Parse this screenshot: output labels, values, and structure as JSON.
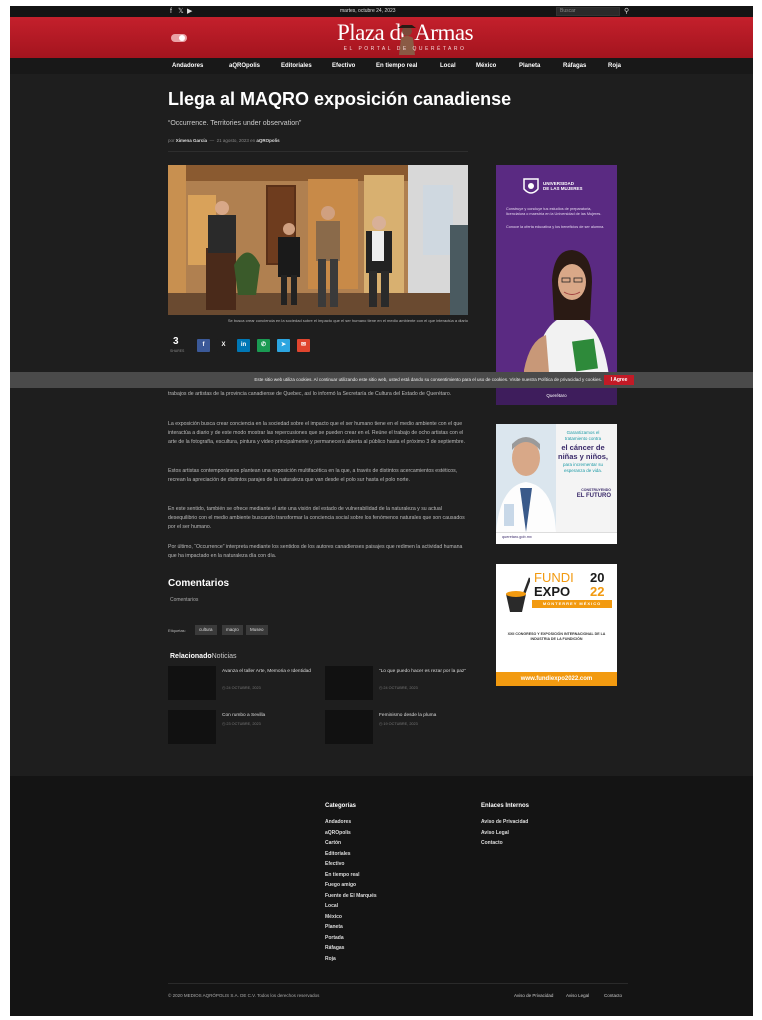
{
  "topbar": {
    "icons": [
      "facebook-icon",
      "x-icon",
      "youtube-icon"
    ],
    "date": "martes, octubre 24, 2023",
    "search_placeholder": "Buscar"
  },
  "logo": {
    "title": "Plaza de Armas",
    "subtitle": "EL PORTAL DE QUERÉTARO"
  },
  "nav": [
    "Andadores",
    "aQROpolis",
    "Editoriales",
    "Efectivo",
    "En tiempo real",
    "Local",
    "México",
    "Planeta",
    "Ráfagas",
    "Roja"
  ],
  "article": {
    "title": "Llega al MAQRO exposición canadiense",
    "subtitle": "“Occurrence. Territories under observation”",
    "byline": {
      "prefix": "por",
      "author": "Ximena García",
      "sep": "—",
      "date": "21 agosto, 2023",
      "in": "en",
      "category": "aQROpolis"
    },
    "caption": "Se busca crear conciencia en la sociedad sobre el impacto que el ser humano tiene en el medio ambiente con el que interactúa a diario",
    "shares": {
      "count": "3",
      "label": "SHARES"
    },
    "paragraphs": [
      "trabajos de artistas de la provincia canadiense de Quebec, así lo informó la Secretaría de Cultura del Estado de Querétaro.",
      "La exposición busca crear conciencia en la sociedad sobre el impacto que el ser humano tiene en el medio ambiente con el que interactúa a diario y de este modo mostrar las repercusiones que se pueden crear en el. Reúne el trabajo de ocho artistas con el arte de la fotografía, escultura, pintura y video principalmente y permanecerá abierta al público hasta el próximo 3 de septiembre.",
      "Estos artistas contemporáneos plantean una exposición multifacética en la que, a través de distintos acercamientos estéticos, recrean la apreciación de distintos parajes de la naturaleza que van desde el polo sur hasta el polo norte.",
      "En este sentido, también se ofrece mediante el arte una visión del estado de vulnerabilidad de la naturaleza y su actual desequilibrio con el medio ambiente buscando transformar la conciencia social sobre los fenómenos naturales que son causados por el ser humano.",
      "Por último, “Occurrence” interpreta mediante los sentidos de los autores canadienses paisajes que redimen la actividad humana que ha impactado en la naturaleza día con día."
    ]
  },
  "share_buttons": [
    {
      "name": "facebook-share-button",
      "glyph": "f",
      "color": "#3b5998"
    },
    {
      "name": "x-share-button",
      "glyph": "X",
      "color": "#1e1e1e"
    },
    {
      "name": "linkedin-share-button",
      "glyph": "in",
      "color": "#0077b5"
    },
    {
      "name": "whatsapp-share-button",
      "glyph": "✆",
      "color": "#1a9a52"
    },
    {
      "name": "telegram-share-button",
      "glyph": "➤",
      "color": "#2ca5e0"
    },
    {
      "name": "email-share-button",
      "glyph": "✉",
      "color": "#e0452e"
    }
  ],
  "cookie": {
    "text": "Este sitio web utiliza cookies. Al continuar utilizando este sitio web, usted está dando su consentimiento para el uso de cookies. Visite nuestra Política de privacidad y cookies.",
    "button": "I Agree"
  },
  "comments": {
    "heading": "Comentarios",
    "text": "Comentarios"
  },
  "tags": {
    "label": "Etiquetas:",
    "items": [
      "cultura",
      "maqro",
      "Museo"
    ]
  },
  "related": {
    "heading_a": "Relacionado",
    "heading_b": "Noticias",
    "items": [
      {
        "title": "Avanza el taller Arte, Memoria e Identidad",
        "date": "◷ 24 OCTUBRE, 2023"
      },
      {
        "title": "“Lo que puedo hacer es rezar por la paz”",
        "date": "◷ 24 OCTUBRE, 2023"
      },
      {
        "title": "Con rumbo a Sevilla",
        "date": "◷ 23 OCTUBRE, 2023"
      },
      {
        "title": "Feminismo desde la pluma",
        "date": "◷ 19 OCTUBRE, 2023"
      }
    ]
  },
  "ads": {
    "uni": {
      "line1": "UNIVERSIDAD",
      "line2": "DE LAS MUJERES",
      "p1": "Construye y concluye tus estudios de preparatoria, licenciatura o maestría en la Universidad de las Mujeres.",
      "p2": "Conoce la oferta educativa y los beneficios de ser alumna.",
      "footer": "Querétaro"
    },
    "cancer": {
      "l1": "Garantizamos el",
      "l2": "tratamiento contra",
      "l3": "el cáncer de",
      "l4": "niñas y niños,",
      "l5": "para incrementar su",
      "l6": "esperanza de vida.",
      "l7": "CONSTRUYENDO",
      "l8": "EL FUTURO",
      "url": "queretaro.gob.mx"
    },
    "expo": {
      "fundi": "FUNDI",
      "year_a": "20",
      "expo": "EXPO",
      "year_b": "22",
      "city": "MONTERREY MÉXICO",
      "desc": "XXII CONGRESO Y EXPOSICIÓN INTERNACIONAL DE LA INDUSTRIA DE LA FUNDICIÓN",
      "url": "www.fundiexpo2022.com"
    }
  },
  "footer": {
    "categories_heading": "Categorías",
    "categories": [
      "Andadores",
      "aQROpolis",
      "Cartón",
      "Editoriales",
      "Efectivo",
      "En tiempo real",
      "Fuego amigo",
      "Fuente de El Marqués",
      "Local",
      "México",
      "Planeta",
      "Portada",
      "Ráfagas",
      "Roja"
    ],
    "links_heading": "Enlaces Internos",
    "links": [
      "Aviso de Privacidad",
      "Aviso Legal",
      "Contacto"
    ],
    "copyright": "© 2020 MEDIOS AQRÓPOLIS S.A. DE C.V. Todos los derechos reservados",
    "bottom_links": [
      "Aviso de Privacidad",
      "Aviso Legal",
      "Contacto"
    ]
  },
  "colors": {
    "brand_red": "#b81c27",
    "background": "#1e1e1e",
    "footer": "#141414"
  }
}
